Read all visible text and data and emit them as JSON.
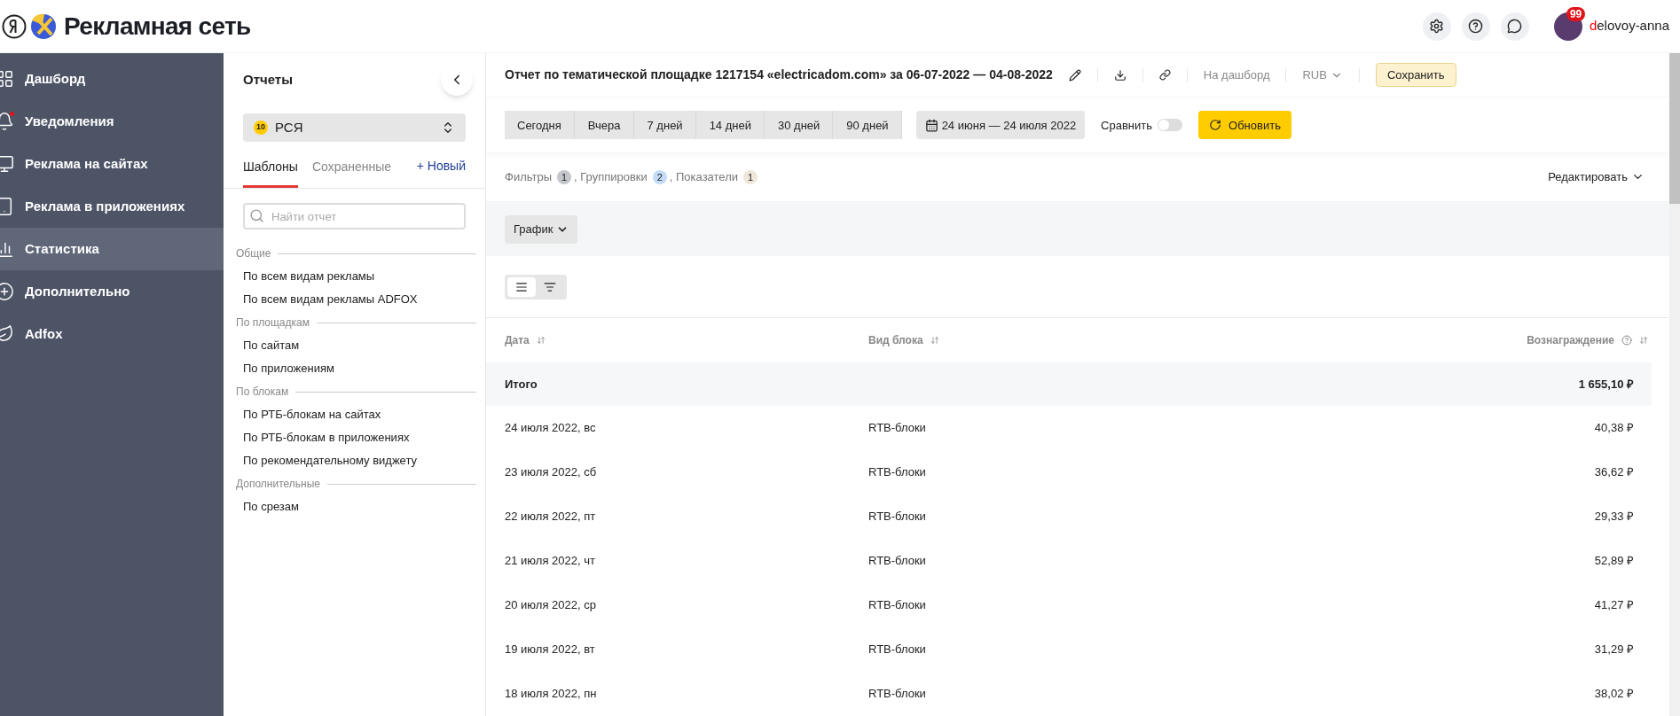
{
  "header": {
    "logo_text": "Рекламная сеть",
    "user": {
      "name": "delovoy-anna",
      "badge": "99"
    }
  },
  "nav": [
    {
      "label": "Дашборд",
      "selected": false,
      "alert": false
    },
    {
      "label": "Уведомления",
      "selected": false,
      "alert": true
    },
    {
      "label": "Реклама на сайтах",
      "selected": false,
      "alert": false
    },
    {
      "label": "Реклама в приложениях",
      "selected": false,
      "alert": false
    },
    {
      "label": "Статистика",
      "selected": true,
      "alert": false
    },
    {
      "label": "Дополнительно",
      "selected": false,
      "alert": false
    },
    {
      "label": "Adfox",
      "selected": false,
      "alert": false
    }
  ],
  "reports_panel": {
    "title": "Отчеты",
    "source": {
      "badge": "10",
      "label": "РСЯ"
    },
    "tabs": [
      {
        "label": "Шаблоны",
        "selected": true
      },
      {
        "label": "Сохраненные",
        "selected": false
      }
    ],
    "new_button": "+ Новый",
    "search": {
      "placeholder": "Найти отчет"
    },
    "groups": [
      {
        "title": "Общие",
        "items": [
          "По всем видам рекламы",
          "По всем видам рекламы ADFOX"
        ]
      },
      {
        "title": "По площадкам",
        "items": [
          "По сайтам",
          "По приложениям"
        ]
      },
      {
        "title": "По блокам",
        "items": [
          "По РТБ-блокам на сайтах",
          "По РТБ-блокам в приложениях",
          "По рекомендательному виджету"
        ]
      },
      {
        "title": "Дополнительные",
        "items": [
          "По срезам"
        ]
      }
    ]
  },
  "report": {
    "title": "Отчет по тематической площадке 1217154 «electricadom.com» за 06-07-2022 — 04-08-2022",
    "dashboard_link": "На дашборд",
    "currency": "RUB",
    "save_button": "Сохранить",
    "periods": [
      {
        "label": "Сегодня",
        "selected": false
      },
      {
        "label": "Вчера",
        "selected": false
      },
      {
        "label": "7 дней",
        "selected": false
      },
      {
        "label": "14 дней",
        "selected": false
      },
      {
        "label": "30 дней",
        "selected": false
      },
      {
        "label": "90 дней",
        "selected": false
      }
    ],
    "date_range": "24 июня — 24 июля 2022",
    "compare": {
      "label": "Сравнить",
      "on": false
    },
    "refresh_button": "Обновить",
    "settings": [
      {
        "label": "Фильтры",
        "count": "1",
        "color": "#c3c6cb"
      },
      {
        "label": ", Группировки",
        "count": "2",
        "color": "#c3dcf7"
      },
      {
        "label": ", Показатели",
        "count": "1",
        "color": "#efe7da"
      }
    ],
    "edit_button": "Редактировать",
    "chart_button": "График",
    "view_toggle": [
      {
        "selected": true
      },
      {
        "selected": false
      }
    ],
    "table": {
      "columns": [
        {
          "label": "Дата",
          "help": false
        },
        {
          "label": "Вид блока",
          "help": false
        },
        {
          "label": "Вознаграждение",
          "help": true
        }
      ],
      "total": {
        "label": "Итого",
        "value": "1 655,10 ₽"
      },
      "rows": [
        [
          "24 июля 2022, вс",
          "RTB-блоки",
          "40,38 ₽"
        ],
        [
          "23 июля 2022, сб",
          "RTB-блоки",
          "36,62 ₽"
        ],
        [
          "22 июля 2022, пт",
          "RTB-блоки",
          "29,33 ₽"
        ],
        [
          "21 июля 2022, чт",
          "RTB-блоки",
          "52,89 ₽"
        ],
        [
          "20 июля 2022, ср",
          "RTB-блоки",
          "41,27 ₽"
        ],
        [
          "19 июля 2022, вт",
          "RTB-блоки",
          "31,29 ₽"
        ],
        [
          "18 июля 2022, пн",
          "RTB-блоки",
          "38,02 ₽"
        ]
      ]
    }
  }
}
